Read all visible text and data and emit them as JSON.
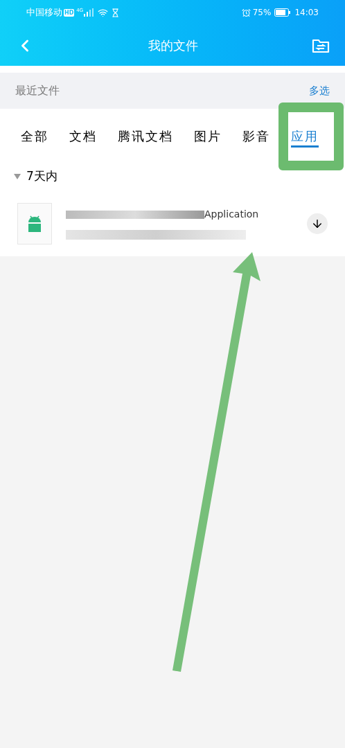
{
  "status_bar": {
    "carrier": "中国移动",
    "hd_badge": "HD",
    "network": "4G",
    "battery_percent": "75%",
    "time": "14:03"
  },
  "header": {
    "title": "我的文件"
  },
  "section": {
    "title": "最近文件",
    "action": "多选"
  },
  "tabs": [
    {
      "label": "全部",
      "selected": false
    },
    {
      "label": "文档",
      "selected": false
    },
    {
      "label": "腾讯文档",
      "selected": false
    },
    {
      "label": "图片",
      "selected": false
    },
    {
      "label": "影音",
      "selected": false
    },
    {
      "label": "应用",
      "selected": true
    }
  ],
  "group": {
    "label": "7天内",
    "expanded": true
  },
  "files": [
    {
      "name_tail": "Application"
    }
  ]
}
